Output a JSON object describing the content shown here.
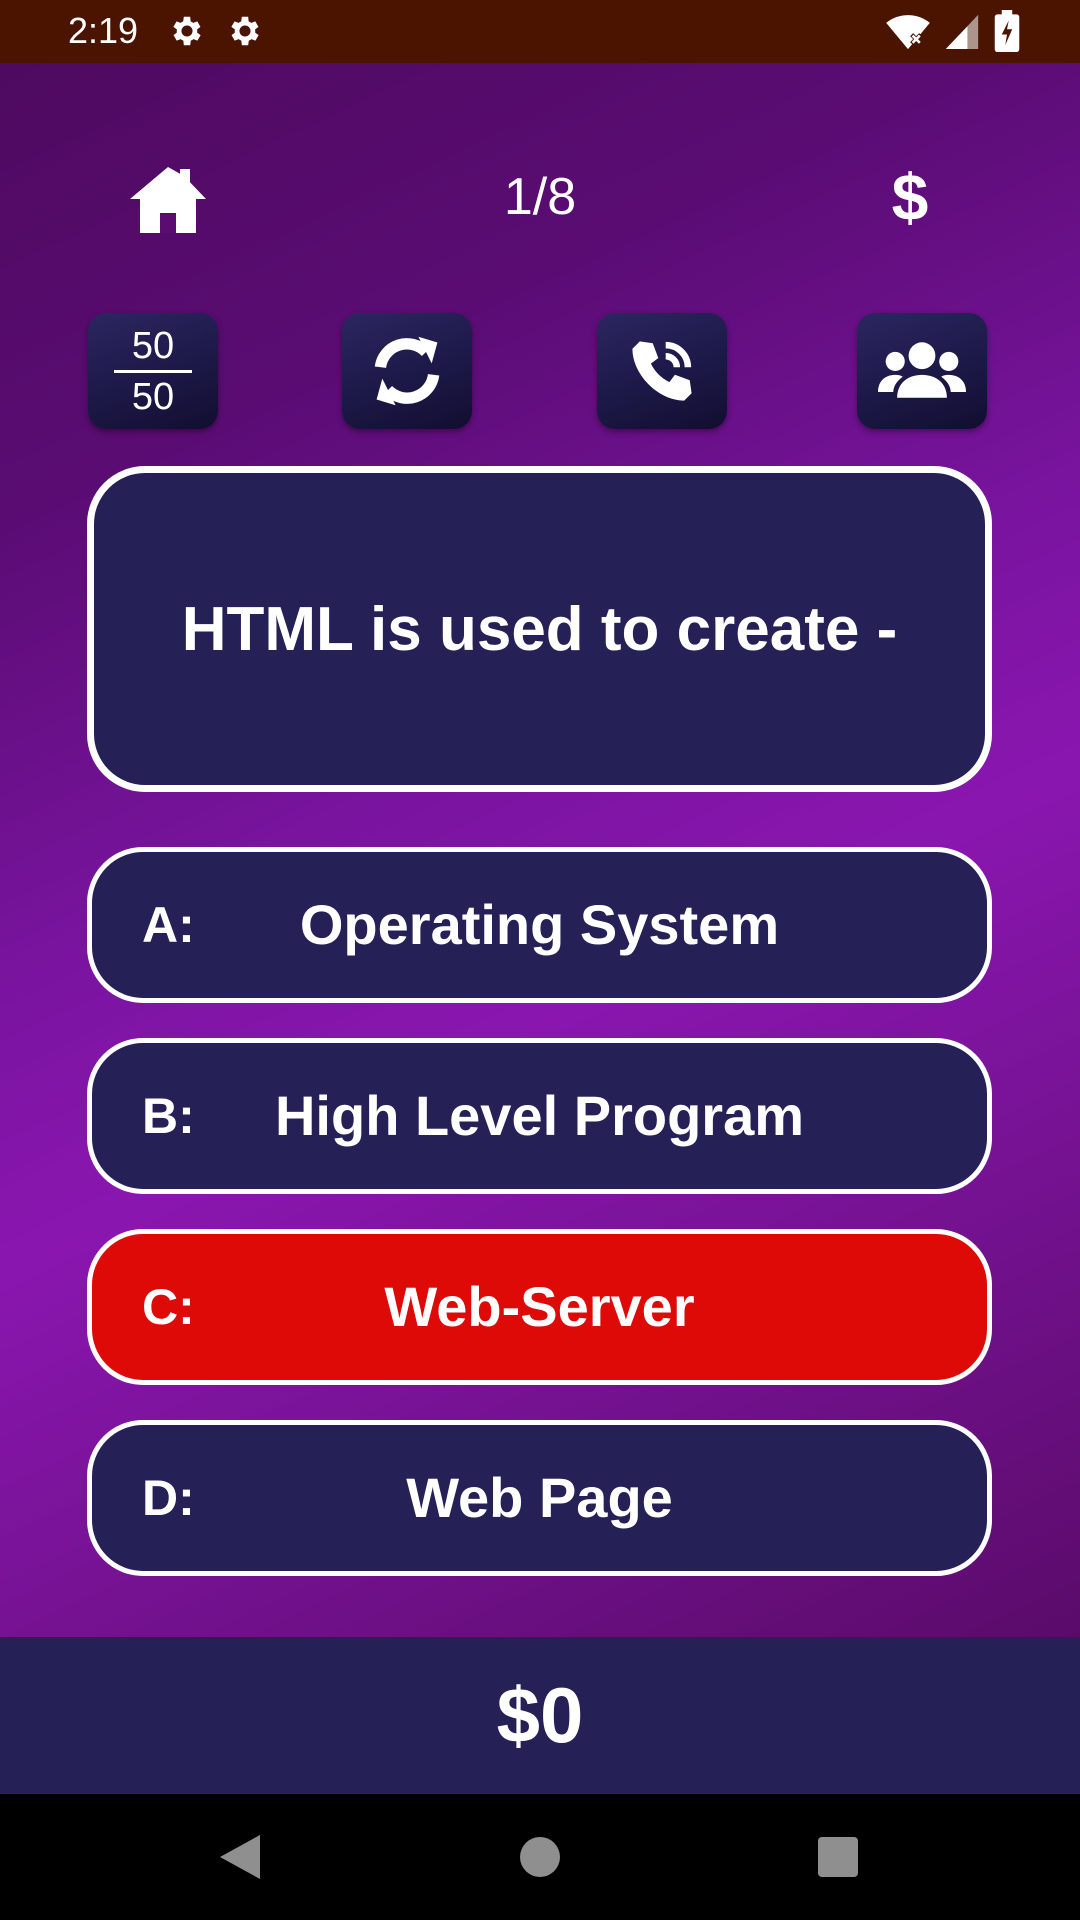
{
  "status_bar": {
    "time": "2:19",
    "icons": [
      "gear-icon",
      "gear-icon",
      "wifi-icon",
      "signal-icon",
      "battery-icon"
    ]
  },
  "top_bar": {
    "home_icon": "home-icon",
    "progress": "1/8",
    "prize_icon_label": "$"
  },
  "lifelines": {
    "fifty_top": "50",
    "fifty_bottom": "50",
    "icons": [
      "fifty-fifty-icon",
      "swap-question-icon",
      "phone-a-friend-icon",
      "ask-audience-icon"
    ]
  },
  "question": {
    "text": "HTML is used to create -"
  },
  "answers": [
    {
      "letter": "A:",
      "text": "Operating System",
      "selected": false
    },
    {
      "letter": "B:",
      "text": "High Level Program",
      "selected": false
    },
    {
      "letter": "C:",
      "text": "Web-Server",
      "selected": true
    },
    {
      "letter": "D:",
      "text": "Web Page",
      "selected": false
    }
  ],
  "prize": {
    "amount": "$0"
  },
  "nav_bar": {
    "icons": [
      "back-icon",
      "home-circle-icon",
      "recents-icon"
    ]
  },
  "colors": {
    "status_bar": "#4a1400",
    "panel": "#252055",
    "selected_answer": "#dd0a08",
    "border": "#ffffff"
  }
}
